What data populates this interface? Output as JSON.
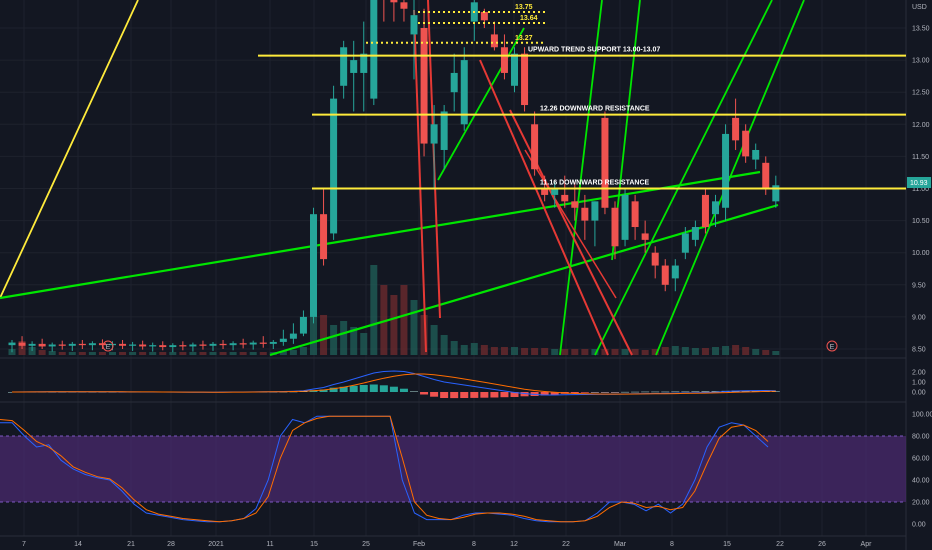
{
  "chart_data": {
    "type": "candlestick",
    "currency_label": "USD",
    "price_axis": {
      "min": 8.5,
      "max": 13.75,
      "ticks": [
        "13.50",
        "13.00",
        "12.50",
        "12.00",
        "11.50",
        "11.00",
        "10.50",
        "10.00",
        "9.50",
        "9.00",
        "8.50"
      ]
    },
    "current_price_tag": "10.93",
    "x_ticks": [
      "7",
      "14",
      "21",
      "28",
      "2021",
      "11",
      "15",
      "25",
      "Feb",
      "8",
      "12",
      "22",
      "Mar",
      "8",
      "15",
      "22",
      "26",
      "Apr"
    ],
    "candles": [
      {
        "o": 8.56,
        "h": 8.64,
        "l": 8.45,
        "c": 8.6
      },
      {
        "o": 8.6,
        "h": 8.7,
        "l": 8.5,
        "c": 8.55
      },
      {
        "o": 8.55,
        "h": 8.62,
        "l": 8.47,
        "c": 8.58
      },
      {
        "o": 8.58,
        "h": 8.66,
        "l": 8.5,
        "c": 8.54
      },
      {
        "o": 8.54,
        "h": 8.6,
        "l": 8.46,
        "c": 8.57
      },
      {
        "o": 8.57,
        "h": 8.63,
        "l": 8.49,
        "c": 8.55
      },
      {
        "o": 8.55,
        "h": 8.61,
        "l": 8.47,
        "c": 8.58
      },
      {
        "o": 8.58,
        "h": 8.64,
        "l": 8.5,
        "c": 8.56
      },
      {
        "o": 8.56,
        "h": 8.62,
        "l": 8.48,
        "c": 8.59
      },
      {
        "o": 8.59,
        "h": 8.65,
        "l": 8.5,
        "c": 8.56
      },
      {
        "o": 8.56,
        "h": 8.62,
        "l": 8.48,
        "c": 8.58
      },
      {
        "o": 8.58,
        "h": 8.64,
        "l": 8.5,
        "c": 8.55
      },
      {
        "o": 8.55,
        "h": 8.61,
        "l": 8.47,
        "c": 8.57
      },
      {
        "o": 8.57,
        "h": 8.63,
        "l": 8.49,
        "c": 8.54
      },
      {
        "o": 8.54,
        "h": 8.6,
        "l": 8.46,
        "c": 8.56
      },
      {
        "o": 8.56,
        "h": 8.62,
        "l": 8.48,
        "c": 8.53
      },
      {
        "o": 8.53,
        "h": 8.59,
        "l": 8.45,
        "c": 8.56
      },
      {
        "o": 8.56,
        "h": 8.62,
        "l": 8.48,
        "c": 8.54
      },
      {
        "o": 8.54,
        "h": 8.6,
        "l": 8.46,
        "c": 8.57
      },
      {
        "o": 8.57,
        "h": 8.63,
        "l": 8.49,
        "c": 8.55
      },
      {
        "o": 8.55,
        "h": 8.61,
        "l": 8.47,
        "c": 8.58
      },
      {
        "o": 8.58,
        "h": 8.64,
        "l": 8.5,
        "c": 8.56
      },
      {
        "o": 8.56,
        "h": 8.62,
        "l": 8.48,
        "c": 8.59
      },
      {
        "o": 8.59,
        "h": 8.66,
        "l": 8.51,
        "c": 8.57
      },
      {
        "o": 8.57,
        "h": 8.63,
        "l": 8.49,
        "c": 8.6
      },
      {
        "o": 8.6,
        "h": 8.7,
        "l": 8.52,
        "c": 8.58
      },
      {
        "o": 8.58,
        "h": 8.64,
        "l": 8.5,
        "c": 8.61
      },
      {
        "o": 8.61,
        "h": 8.8,
        "l": 8.55,
        "c": 8.66
      },
      {
        "o": 8.66,
        "h": 8.9,
        "l": 8.58,
        "c": 8.74
      },
      {
        "o": 8.74,
        "h": 9.1,
        "l": 8.7,
        "c": 9.0
      },
      {
        "o": 9.0,
        "h": 10.7,
        "l": 8.9,
        "c": 10.6
      },
      {
        "o": 10.6,
        "h": 11.0,
        "l": 9.8,
        "c": 9.9
      },
      {
        "o": 10.3,
        "h": 12.6,
        "l": 10.2,
        "c": 12.4
      },
      {
        "o": 12.6,
        "h": 13.3,
        "l": 12.4,
        "c": 13.2
      },
      {
        "o": 12.8,
        "h": 13.3,
        "l": 12.2,
        "c": 13.0
      },
      {
        "o": 12.8,
        "h": 13.6,
        "l": 12.2,
        "c": 13.1
      },
      {
        "o": 12.4,
        "h": 14.2,
        "l": 12.3,
        "c": 14.1
      },
      {
        "o": 14.4,
        "h": 14.8,
        "l": 13.6,
        "c": 14.0
      },
      {
        "o": 14.2,
        "h": 14.9,
        "l": 13.6,
        "c": 13.9
      },
      {
        "o": 13.9,
        "h": 14.8,
        "l": 13.6,
        "c": 13.8
      },
      {
        "o": 13.4,
        "h": 14.8,
        "l": 12.7,
        "c": 13.7
      },
      {
        "o": 13.5,
        "h": 13.8,
        "l": 11.5,
        "c": 11.7
      },
      {
        "o": 11.7,
        "h": 12.3,
        "l": 11.0,
        "c": 12.0
      },
      {
        "o": 11.6,
        "h": 12.3,
        "l": 11.3,
        "c": 12.2
      },
      {
        "o": 12.5,
        "h": 13.1,
        "l": 12.2,
        "c": 12.8
      },
      {
        "o": 12.0,
        "h": 13.2,
        "l": 11.9,
        "c": 13.0
      },
      {
        "o": 13.6,
        "h": 14.0,
        "l": 13.3,
        "c": 13.9
      },
      {
        "o": 13.75,
        "h": 13.8,
        "l": 13.5,
        "c": 13.62
      },
      {
        "o": 13.4,
        "h": 13.6,
        "l": 13.15,
        "c": 13.2
      },
      {
        "o": 13.2,
        "h": 13.4,
        "l": 12.7,
        "c": 12.8
      },
      {
        "o": 12.6,
        "h": 13.2,
        "l": 12.5,
        "c": 13.1
      },
      {
        "o": 13.1,
        "h": 13.2,
        "l": 12.2,
        "c": 12.3
      },
      {
        "o": 12.0,
        "h": 12.2,
        "l": 11.2,
        "c": 11.3
      },
      {
        "o": 11.0,
        "h": 11.2,
        "l": 10.8,
        "c": 10.9
      },
      {
        "o": 10.9,
        "h": 11.1,
        "l": 10.7,
        "c": 11.0
      },
      {
        "o": 10.9,
        "h": 11.2,
        "l": 10.7,
        "c": 10.8
      },
      {
        "o": 10.8,
        "h": 11.1,
        "l": 10.5,
        "c": 10.7
      },
      {
        "o": 10.7,
        "h": 10.9,
        "l": 10.2,
        "c": 10.5
      },
      {
        "o": 10.5,
        "h": 10.8,
        "l": 10.1,
        "c": 10.8
      },
      {
        "o": 12.1,
        "h": 12.2,
        "l": 10.6,
        "c": 10.7
      },
      {
        "o": 10.7,
        "h": 10.8,
        "l": 9.9,
        "c": 10.1
      },
      {
        "o": 10.2,
        "h": 11.0,
        "l": 10.1,
        "c": 10.9
      },
      {
        "o": 10.8,
        "h": 10.9,
        "l": 10.2,
        "c": 10.4
      },
      {
        "o": 10.3,
        "h": 10.5,
        "l": 10.0,
        "c": 10.2
      },
      {
        "o": 10.0,
        "h": 10.1,
        "l": 9.6,
        "c": 9.8
      },
      {
        "o": 9.8,
        "h": 9.9,
        "l": 9.4,
        "c": 9.5
      },
      {
        "o": 9.6,
        "h": 9.9,
        "l": 9.4,
        "c": 9.8
      },
      {
        "o": 10.0,
        "h": 10.4,
        "l": 9.9,
        "c": 10.3
      },
      {
        "o": 10.2,
        "h": 10.5,
        "l": 10.1,
        "c": 10.4
      },
      {
        "o": 10.9,
        "h": 11.0,
        "l": 10.3,
        "c": 10.4
      },
      {
        "o": 10.6,
        "h": 10.9,
        "l": 10.4,
        "c": 10.8
      },
      {
        "o": 10.7,
        "h": 12.0,
        "l": 10.5,
        "c": 11.85
      },
      {
        "o": 12.1,
        "h": 12.4,
        "l": 11.6,
        "c": 11.75
      },
      {
        "o": 11.9,
        "h": 12.0,
        "l": 11.4,
        "c": 11.5
      },
      {
        "o": 11.45,
        "h": 11.7,
        "l": 11.3,
        "c": 11.6
      },
      {
        "o": 11.4,
        "h": 11.5,
        "l": 10.9,
        "c": 11.0
      },
      {
        "o": 10.8,
        "h": 11.2,
        "l": 10.7,
        "c": 11.05
      }
    ],
    "horizontal_levels": [
      {
        "price": 13.07,
        "label": "UPWARD TREND SUPPORT 13.00-13.07",
        "color": "#ffeb3b"
      },
      {
        "price": 12.15,
        "label": "12.26 DOWNWARD RESISTANCE",
        "color": "#ffeb3b"
      },
      {
        "price": 11.0,
        "label": "11.16 DOWNWARD RESISTANCE",
        "color": "#ffeb3b"
      }
    ],
    "dotted_levels": [
      {
        "price": 13.75,
        "label": "13.75"
      },
      {
        "price": 13.64,
        "label": "13.64"
      },
      {
        "price": 13.27,
        "label": "13.27"
      }
    ],
    "event_markers": [
      "E",
      "E"
    ],
    "macd": {
      "ticks": [
        "2.00",
        "1.00",
        "0.00"
      ],
      "range": [
        -0.5,
        2.6
      ],
      "macd_line": [
        0.0,
        0.01,
        0.01,
        0.02,
        0.02,
        0.02,
        0.03,
        0.03,
        0.02,
        0.02,
        0.02,
        0.01,
        0.01,
        0.0,
        0.0,
        0.0,
        -0.01,
        -0.01,
        -0.02,
        -0.02,
        -0.02,
        -0.01,
        0.0,
        0.0,
        0.01,
        0.02,
        0.03,
        0.05,
        0.08,
        0.12,
        0.3,
        0.45,
        0.75,
        1.0,
        1.3,
        1.6,
        1.9,
        2.05,
        2.1,
        2.05,
        1.85,
        1.55,
        1.25,
        1.0,
        0.85,
        0.7,
        0.55,
        0.4,
        0.25,
        0.1,
        -0.05,
        -0.15,
        -0.25,
        -0.3,
        -0.3,
        -0.28,
        -0.26,
        -0.25,
        -0.24,
        -0.23,
        -0.22,
        -0.2,
        -0.18,
        -0.16,
        -0.15,
        -0.14,
        -0.12,
        -0.1,
        -0.08,
        -0.05,
        -0.02,
        0.05,
        0.1,
        0.12,
        0.14,
        0.15,
        0.13
      ],
      "signal_line": [
        0.0,
        0.0,
        0.01,
        0.01,
        0.02,
        0.02,
        0.02,
        0.02,
        0.02,
        0.02,
        0.02,
        0.02,
        0.01,
        0.01,
        0.01,
        0.0,
        0.0,
        -0.01,
        -0.01,
        -0.01,
        -0.02,
        -0.02,
        -0.01,
        -0.01,
        0.0,
        0.01,
        0.02,
        0.03,
        0.05,
        0.07,
        0.12,
        0.2,
        0.32,
        0.48,
        0.68,
        0.9,
        1.15,
        1.38,
        1.57,
        1.72,
        1.8,
        1.8,
        1.72,
        1.6,
        1.46,
        1.3,
        1.14,
        0.97,
        0.8,
        0.62,
        0.45,
        0.28,
        0.15,
        0.05,
        -0.03,
        -0.1,
        -0.15,
        -0.18,
        -0.2,
        -0.21,
        -0.21,
        -0.21,
        -0.2,
        -0.19,
        -0.18,
        -0.17,
        -0.16,
        -0.14,
        -0.13,
        -0.11,
        -0.09,
        -0.06,
        -0.03,
        0.0,
        0.03,
        0.06,
        0.08
      ]
    },
    "stochastic": {
      "ticks": [
        "100.00",
        "80.00",
        "60.00",
        "40.00",
        "20.00",
        "0.00"
      ],
      "band": [
        20,
        80
      ],
      "k": [
        92,
        92,
        80,
        70,
        72,
        58,
        50,
        45,
        42,
        40,
        30,
        18,
        10,
        8,
        6,
        4,
        3,
        2,
        2,
        3,
        5,
        14,
        40,
        80,
        95,
        92,
        98,
        98,
        98,
        98,
        98,
        98,
        98,
        40,
        10,
        4,
        4,
        4,
        8,
        10,
        10,
        9,
        8,
        5,
        3,
        2,
        2,
        2,
        3,
        10,
        20,
        20,
        18,
        12,
        18,
        10,
        18,
        40,
        70,
        88,
        92,
        90,
        80,
        70
      ],
      "d": [
        95,
        94,
        85,
        75,
        70,
        62,
        52,
        47,
        43,
        41,
        33,
        22,
        13,
        9,
        7,
        5,
        4,
        3,
        2,
        3,
        5,
        10,
        25,
        60,
        85,
        92,
        96,
        98,
        98,
        98,
        98,
        98,
        98,
        60,
        20,
        8,
        5,
        4,
        6,
        9,
        10,
        10,
        9,
        7,
        4,
        3,
        2,
        2,
        3,
        7,
        15,
        20,
        19,
        15,
        16,
        13,
        15,
        30,
        55,
        78,
        88,
        90,
        85,
        75
      ]
    },
    "colors": {
      "up": "#26a69a",
      "down": "#ef5350",
      "support": "#00e600",
      "level": "#ffeb3b",
      "macd": "#2962ff",
      "signal": "#ff6d00",
      "stoch_k": "#2962ff",
      "stoch_d": "#ff6d00",
      "band_fill": "#4a2a6e"
    }
  }
}
